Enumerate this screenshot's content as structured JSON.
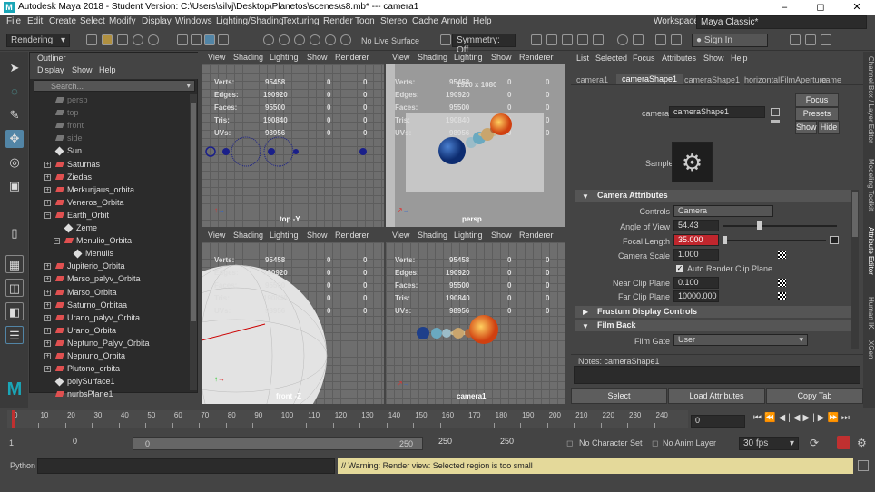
{
  "window": {
    "title": "Autodesk Maya 2018 - Student Version: C:\\Users\\silvj\\Desktop\\Planetos\\scenes\\s8.mb*   ---   camera1",
    "logo": "M",
    "minimize": "–",
    "maximize": "◻",
    "close": "✕"
  },
  "menu": [
    "File",
    "Edit",
    "Create",
    "Select",
    "Modify",
    "Display",
    "Windows",
    "Lighting/Shading",
    "Texturing",
    "Render",
    "Toon",
    "Stereo",
    "Cache",
    "Arnold",
    "Help"
  ],
  "workspace": {
    "label": "Workspace :",
    "value": "Maya Classic*"
  },
  "toolbar": {
    "menuset": "Rendering",
    "live_surface": "No Live Surface",
    "symmetry": "Symmetry: Off",
    "sign_in": "Sign In"
  },
  "outliner": {
    "title": "Outliner",
    "menu": [
      "Display",
      "Show",
      "Help"
    ],
    "search_placeholder": "Search...",
    "items": [
      {
        "label": "persp",
        "indent": 0,
        "exp": "",
        "kind": "cam",
        "dim": true
      },
      {
        "label": "top",
        "indent": 0,
        "exp": "",
        "kind": "cam",
        "dim": true
      },
      {
        "label": "front",
        "indent": 0,
        "exp": "",
        "kind": "cam",
        "dim": true
      },
      {
        "label": "side",
        "indent": 0,
        "exp": "",
        "kind": "cam",
        "dim": true
      },
      {
        "label": "Sun",
        "indent": 0,
        "exp": "",
        "kind": "shape",
        "dim": false
      },
      {
        "label": "Saturnas",
        "indent": 0,
        "exp": "+",
        "kind": "mesh",
        "dim": false
      },
      {
        "label": "Ziedas",
        "indent": 0,
        "exp": "+",
        "kind": "mesh",
        "dim": false
      },
      {
        "label": "Merkurijaus_orbita",
        "indent": 0,
        "exp": "+",
        "kind": "mesh",
        "dim": false
      },
      {
        "label": "Veneros_Orbita",
        "indent": 0,
        "exp": "+",
        "kind": "mesh",
        "dim": false
      },
      {
        "label": "Earth_Orbit",
        "indent": 0,
        "exp": "−",
        "kind": "mesh",
        "dim": false
      },
      {
        "label": "Zeme",
        "indent": 1,
        "exp": "",
        "kind": "shape",
        "dim": false
      },
      {
        "label": "Menulio_Orbita",
        "indent": 1,
        "exp": "−",
        "kind": "mesh",
        "dim": false
      },
      {
        "label": "Menulis",
        "indent": 2,
        "exp": "",
        "kind": "shape",
        "dim": false
      },
      {
        "label": "Jupiterio_Orbita",
        "indent": 0,
        "exp": "+",
        "kind": "mesh",
        "dim": false
      },
      {
        "label": "Marso_palyv_Orbita",
        "indent": 0,
        "exp": "+",
        "kind": "mesh",
        "dim": false
      },
      {
        "label": "Marso_Orbita",
        "indent": 0,
        "exp": "+",
        "kind": "mesh",
        "dim": false
      },
      {
        "label": "Saturno_Orbitaa",
        "indent": 0,
        "exp": "+",
        "kind": "mesh",
        "dim": false
      },
      {
        "label": "Urano_palyv_Orbita",
        "indent": 0,
        "exp": "+",
        "kind": "mesh",
        "dim": false
      },
      {
        "label": "Urano_Orbita",
        "indent": 0,
        "exp": "+",
        "kind": "mesh",
        "dim": false
      },
      {
        "label": "Neptuno_Palyv_Orbita",
        "indent": 0,
        "exp": "+",
        "kind": "mesh",
        "dim": false
      },
      {
        "label": "Nepruno_Orbita",
        "indent": 0,
        "exp": "+",
        "kind": "mesh",
        "dim": false
      },
      {
        "label": "Plutono_orbita",
        "indent": 0,
        "exp": "+",
        "kind": "mesh",
        "dim": false
      },
      {
        "label": "polySurface1",
        "indent": 0,
        "exp": "",
        "kind": "shape",
        "dim": false
      },
      {
        "label": "nurbsPlane1",
        "indent": 0,
        "exp": "",
        "kind": "mesh",
        "dim": false
      }
    ]
  },
  "viewport_menu": [
    "View",
    "Shading",
    "Lighting",
    "Show",
    "Renderer"
  ],
  "hud": {
    "labels": [
      "Verts:",
      "Edges:",
      "Faces:",
      "Tris:",
      "UVs:"
    ],
    "values": [
      "95458",
      "190920",
      "95500",
      "190840",
      "98956"
    ],
    "zeros": [
      "0",
      "0",
      "0",
      "0",
      "0"
    ]
  },
  "viewports": {
    "top": "top -Y",
    "persp": "persp",
    "front": "front -Z",
    "camera": "camera1",
    "resolution": "1920 x 1080"
  },
  "attr": {
    "menu": [
      "List",
      "Selected",
      "Focus",
      "Attributes",
      "Show",
      "Help"
    ],
    "tabs": [
      "camera1",
      "cameraShape1",
      "cameraShape1_horizontalFilmAperture",
      "came"
    ],
    "node_label": "camera:",
    "node_value": "cameraShape1",
    "buttons": {
      "focus": "Focus",
      "presets": "Presets",
      "show": "Show",
      "hide": "Hide"
    },
    "sample": "Sample",
    "section_camera": "Camera Attributes",
    "controls_label": "Controls",
    "controls_value": "Camera",
    "angle_label": "Angle of View",
    "angle_value": "54.43",
    "focal_label": "Focal Length",
    "focal_value": "35.000",
    "scale_label": "Camera Scale",
    "scale_value": "1.000",
    "auto_clip": "Auto Render Clip Plane",
    "near_label": "Near Clip Plane",
    "near_value": "0.100",
    "far_label": "Far Clip Plane",
    "far_value": "10000.000",
    "section_frustum": "Frustum Display Controls",
    "section_filmback": "Film Back",
    "filmgate_label": "Film Gate",
    "filmgate_value": "User",
    "notes": "Notes: cameraShape1",
    "bottom_buttons": [
      "Select",
      "Load Attributes",
      "Copy Tab"
    ]
  },
  "right_tabs": [
    "Channel Box / Layer Editor",
    "Modeling Toolkit",
    "Attribute Editor",
    "Human IK",
    "XGen"
  ],
  "timeline": {
    "ticks": [
      "0",
      "10",
      "20",
      "30",
      "40",
      "50",
      "60",
      "70",
      "80",
      "90",
      "100",
      "110",
      "120",
      "130",
      "140",
      "150",
      "160",
      "170",
      "180",
      "190",
      "200",
      "210",
      "220",
      "230",
      "240"
    ],
    "current_frame_field": "0",
    "current_frame": 0,
    "max_frame": 250
  },
  "range": {
    "start": "1",
    "anim_start": "0",
    "slider_start": "0",
    "slider_end": "250",
    "end": "250",
    "anim_end": "250",
    "character": "No Character Set",
    "anim_layer": "No Anim Layer",
    "fps": "30 fps"
  },
  "command": {
    "lang": "Python",
    "warning": "// Warning: Render view: Selected region is too small"
  },
  "colors": {
    "accent": "#5285a6",
    "focal_field": "#c0262d",
    "warning_bg": "#e4d99a",
    "timeline_marker": "#c03030"
  }
}
